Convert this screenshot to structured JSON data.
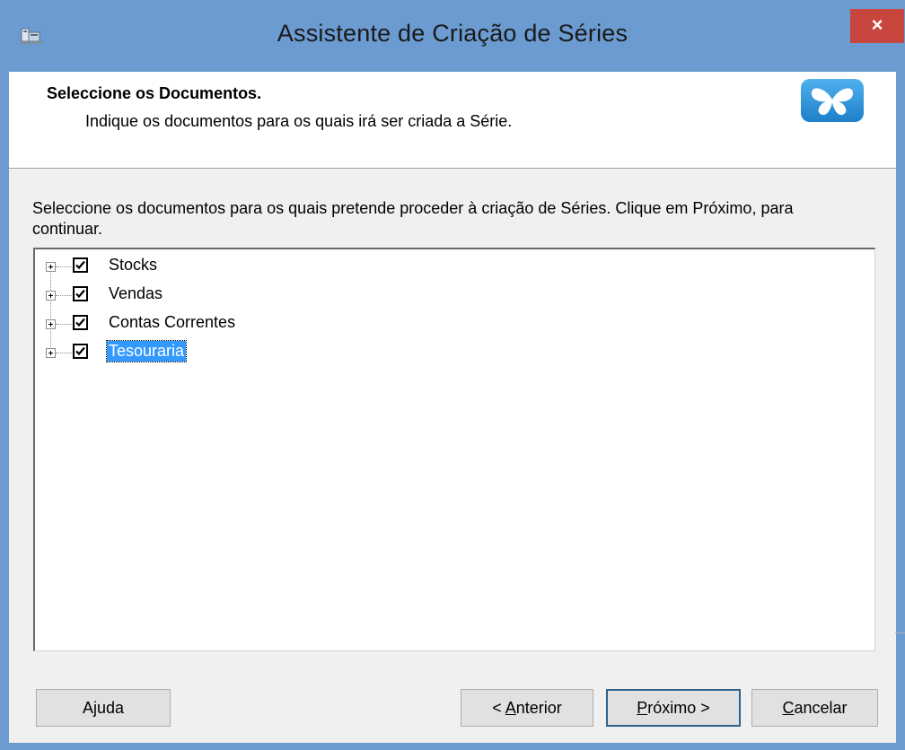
{
  "window": {
    "title": "Assistente de Criação de Séries",
    "close_label": "×"
  },
  "header": {
    "title": "Seleccione os Documentos.",
    "subtitle": "Indique os documentos para os quais irá ser criada a Série."
  },
  "instructions": "Seleccione os documentos para os quais pretende proceder à criação de Séries. Clique em Próximo, para continuar.",
  "tree": {
    "items": [
      {
        "label": "Stocks",
        "checked": true,
        "selected": false
      },
      {
        "label": "Vendas",
        "checked": true,
        "selected": false
      },
      {
        "label": "Contas Correntes",
        "checked": true,
        "selected": false
      },
      {
        "label": "Tesouraria",
        "checked": true,
        "selected": true
      }
    ]
  },
  "buttons": {
    "help": "Ajuda",
    "previous_prefix": "< ",
    "previous_mnemonic": "A",
    "previous_rest": "nterior",
    "next_mnemonic": "P",
    "next_rest": "róximo >",
    "cancel_mnemonic": "C",
    "cancel_rest": "ancelar"
  },
  "colors": {
    "titlebar": "#6b9bd1",
    "close": "#c7463d",
    "selection": "#3399ff",
    "logo": "#2b8fd6"
  }
}
